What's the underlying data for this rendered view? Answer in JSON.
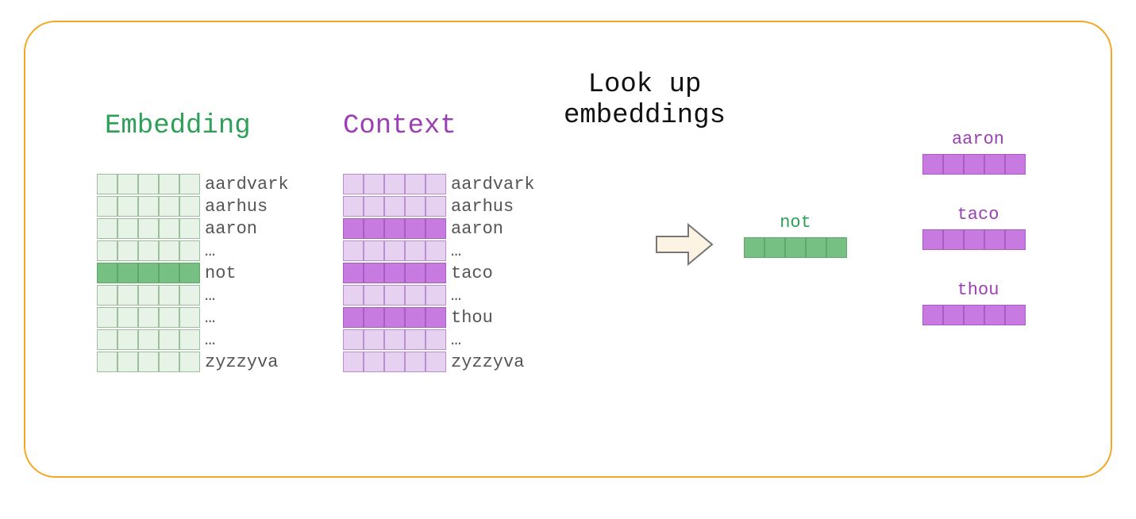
{
  "titles": {
    "embedding": "Embedding",
    "context": "Context",
    "lookup_line1": "Look up",
    "lookup_line2": "embeddings"
  },
  "embedding_matrix": {
    "columns": 5,
    "rows": [
      {
        "label": "aardvark",
        "highlight": false
      },
      {
        "label": "aarhus",
        "highlight": false
      },
      {
        "label": "aaron",
        "highlight": false
      },
      {
        "label": "…",
        "highlight": false
      },
      {
        "label": "not",
        "highlight": true
      },
      {
        "label": "…",
        "highlight": false
      },
      {
        "label": "…",
        "highlight": false
      },
      {
        "label": "…",
        "highlight": false
      },
      {
        "label": "zyzzyva",
        "highlight": false
      }
    ]
  },
  "context_matrix": {
    "columns": 5,
    "rows": [
      {
        "label": "aardvark",
        "highlight": false
      },
      {
        "label": "aarhus",
        "highlight": false
      },
      {
        "label": "aaron",
        "highlight": true
      },
      {
        "label": "…",
        "highlight": false
      },
      {
        "label": "taco",
        "highlight": true
      },
      {
        "label": "…",
        "highlight": false
      },
      {
        "label": "thou",
        "highlight": true
      },
      {
        "label": "…",
        "highlight": false
      },
      {
        "label": "zyzzyva",
        "highlight": false
      }
    ]
  },
  "lookup": {
    "target": {
      "label": "not",
      "color": "green"
    },
    "contexts": [
      {
        "label": "aaron",
        "color": "purple"
      },
      {
        "label": "taco",
        "color": "purple"
      },
      {
        "label": "thou",
        "color": "purple"
      }
    ]
  },
  "colors": {
    "frame": "#f5a623",
    "embedding_light": "#e6f3e6",
    "embedding_dark": "#76c083",
    "context_light": "#e7d1f0",
    "context_dark": "#c77adf",
    "green_text": "#2e9f57",
    "purple_text": "#9c3fb5"
  }
}
